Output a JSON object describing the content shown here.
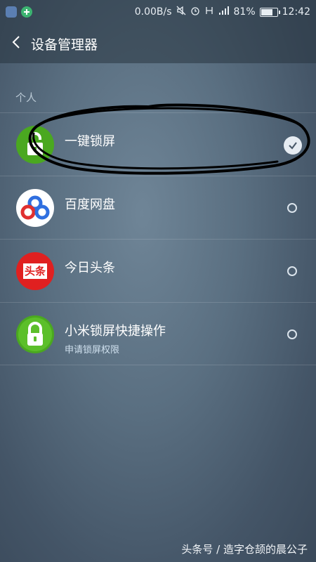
{
  "status_bar": {
    "network_speed": "0.00B/s",
    "battery_percent": "81%",
    "battery_level": 0.81,
    "time": "12:42"
  },
  "header": {
    "title": "设备管理器"
  },
  "section": {
    "label": "个人"
  },
  "apps": [
    {
      "name": "一键锁屏",
      "subtitle": "",
      "checked": true,
      "icon": "green-lock-icon"
    },
    {
      "name": "百度网盘",
      "subtitle": "",
      "checked": false,
      "icon": "baidu-cloud-icon"
    },
    {
      "name": "今日头条",
      "subtitle": "",
      "checked": false,
      "icon": "toutiao-icon"
    },
    {
      "name": "小米锁屏快捷操作",
      "subtitle": "申请锁屏权限",
      "checked": false,
      "icon": "green-lock-icon"
    }
  ],
  "toutiao_icon_text": "头条",
  "watermark": "头条号 / 造字仓颉的晨公子",
  "colors": {
    "lock_green": "#4aa820",
    "baidu_blue": "#2f6fe0",
    "toutiao_red": "#e02020"
  }
}
